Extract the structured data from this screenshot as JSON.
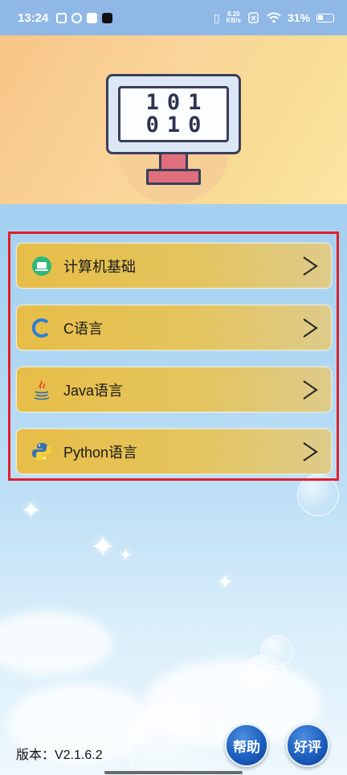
{
  "status_bar": {
    "time": "13:24",
    "net_speed_value": "8.20",
    "net_speed_unit": "KB/s",
    "battery": "31%"
  },
  "banner": {
    "screen_line1": "101",
    "screen_line2": "010"
  },
  "menu": {
    "items": [
      {
        "label": "计算机基础",
        "icon": "laptop-icon"
      },
      {
        "label": "C语言",
        "icon": "c-language-icon"
      },
      {
        "label": "Java语言",
        "icon": "java-icon"
      },
      {
        "label": "Python语言",
        "icon": "python-icon"
      }
    ],
    "highlight_color": "#e0202a"
  },
  "footer": {
    "version": "版本：V2.1.6.2",
    "help_label": "帮助",
    "rate_label": "好评"
  }
}
